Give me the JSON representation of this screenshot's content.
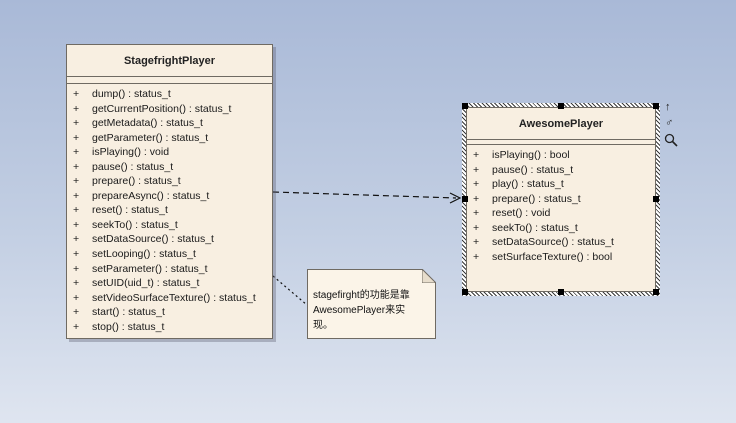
{
  "stagefright": {
    "name": "StagefrightPlayer",
    "operations": [
      {
        "vis": "+",
        "sig": "dump() : status_t"
      },
      {
        "vis": "+",
        "sig": "getCurrentPosition() : status_t"
      },
      {
        "vis": "+",
        "sig": "getMetadata() : status_t"
      },
      {
        "vis": "+",
        "sig": "getParameter() : status_t"
      },
      {
        "vis": "+",
        "sig": "isPlaying() : void"
      },
      {
        "vis": "+",
        "sig": "pause() : status_t"
      },
      {
        "vis": "+",
        "sig": "prepare() : status_t"
      },
      {
        "vis": "+",
        "sig": "prepareAsync() : status_t"
      },
      {
        "vis": "+",
        "sig": "reset() : status_t"
      },
      {
        "vis": "+",
        "sig": "seekTo() : status_t"
      },
      {
        "vis": "+",
        "sig": "setDataSource() : status_t"
      },
      {
        "vis": "+",
        "sig": "setLooping() : status_t"
      },
      {
        "vis": "+",
        "sig": "setParameter() : status_t"
      },
      {
        "vis": "+",
        "sig": "setUID(uid_t) : status_t"
      },
      {
        "vis": "+",
        "sig": "setVideoSurfaceTexture() : status_t"
      },
      {
        "vis": "+",
        "sig": "start() : status_t"
      },
      {
        "vis": "+",
        "sig": "stop() : status_t"
      }
    ]
  },
  "awesome": {
    "name": "AwesomePlayer",
    "operations": [
      {
        "vis": "+",
        "sig": "isPlaying() : bool"
      },
      {
        "vis": "+",
        "sig": "pause() : status_t"
      },
      {
        "vis": "+",
        "sig": "play() : status_t"
      },
      {
        "vis": "+",
        "sig": "prepare() : status_t"
      },
      {
        "vis": "+",
        "sig": "reset() : void"
      },
      {
        "vis": "+",
        "sig": "seekTo() : status_t"
      },
      {
        "vis": "+",
        "sig": "setDataSource() : status_t"
      },
      {
        "vis": "+",
        "sig": "setSurfaceTexture() : bool"
      }
    ]
  },
  "note": {
    "line1": "stagefirght的功能是靠",
    "line2": "AwesomePlayer来实",
    "line3": "现。"
  },
  "icons": {
    "arrow_up": "↑",
    "link": "♂",
    "zoom": "🔍"
  },
  "colors": {
    "class_fill": "#f8efe1",
    "border": "#6f6a62",
    "background_top": "#a9b9d7"
  }
}
